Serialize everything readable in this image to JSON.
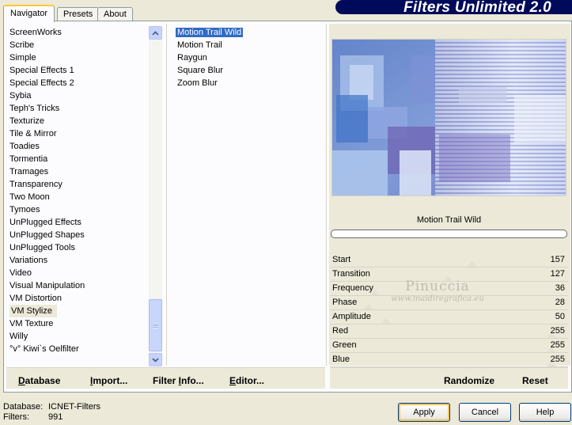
{
  "tabs": [
    {
      "label": "Navigator",
      "active": true
    },
    {
      "label": "Presets",
      "active": false
    },
    {
      "label": "About",
      "active": false
    }
  ],
  "title": "Filters Unlimited 2.0",
  "categories": [
    "ScreenWorks",
    "Scribe",
    "Simple",
    "Special Effects 1",
    "Special Effects 2",
    "Sybia",
    "Teph's Tricks",
    "Texturize",
    "Tile & Mirror",
    "Toadies",
    "Tormentia",
    "Tramages",
    "Transparency",
    "Two Moon",
    "Tymoes",
    "UnPlugged Effects",
    "UnPlugged Shapes",
    "UnPlugged Tools",
    "Variations",
    "Video",
    "Visual Manipulation",
    "VM Distortion",
    "VM Stylize",
    "VM Texture",
    "Willy",
    "°v° Kiwi`s Oelfilter"
  ],
  "selected_category": "VM Stylize",
  "filters": [
    "Motion Trail Wild",
    "Motion Trail",
    "Raygun",
    "Square Blur",
    "Zoom Blur"
  ],
  "selected_filter": "Motion Trail Wild",
  "preview": {
    "filter_name": "Motion Trail Wild"
  },
  "sliders": [
    {
      "label": "Start",
      "value": "157"
    },
    {
      "label": "Transition",
      "value": "127"
    },
    {
      "label": "Frequency",
      "value": "36"
    },
    {
      "label": "Phase",
      "value": "28"
    },
    {
      "label": "Amplitude",
      "value": "50"
    },
    {
      "label": "Red",
      "value": "255"
    },
    {
      "label": "Green",
      "value": "255"
    },
    {
      "label": "Blue",
      "value": "255"
    }
  ],
  "watermark": {
    "name": "Pinuccia",
    "url": "www.maidiregrafica.eu"
  },
  "left_buttons": {
    "database": {
      "u": "D",
      "rest": "atabase"
    },
    "import": {
      "u": "I",
      "rest": "mport..."
    },
    "filter_info": {
      "before": "Filter ",
      "u": "I",
      "after": "nfo..."
    },
    "editor": {
      "u": "E",
      "rest": "ditor..."
    }
  },
  "right_buttons": {
    "randomize": "Randomize",
    "reset": "Reset"
  },
  "status": {
    "database_label": "Database:",
    "database_value": "ICNET-Filters",
    "filters_label": "Filters:",
    "filters_value": "991"
  },
  "dialog_buttons": {
    "apply": "Apply",
    "cancel": "Cancel",
    "help": "Help"
  },
  "colors": {
    "selection": "#316ac5",
    "panel": "#ece9d8",
    "banner": "#000a5a"
  },
  "icons": {
    "scroll_up": "chevron-up-icon",
    "scroll_down": "chevron-down-icon"
  }
}
